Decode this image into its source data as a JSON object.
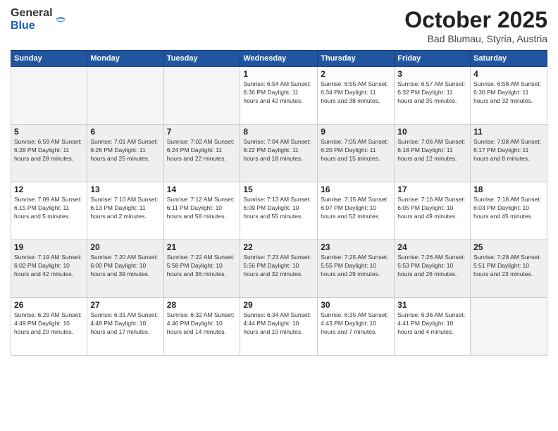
{
  "logo": {
    "general": "General",
    "blue": "Blue"
  },
  "header": {
    "month": "October 2025",
    "location": "Bad Blumau, Styria, Austria"
  },
  "weekdays": [
    "Sunday",
    "Monday",
    "Tuesday",
    "Wednesday",
    "Thursday",
    "Friday",
    "Saturday"
  ],
  "weeks": [
    [
      {
        "day": "",
        "info": ""
      },
      {
        "day": "",
        "info": ""
      },
      {
        "day": "",
        "info": ""
      },
      {
        "day": "1",
        "info": "Sunrise: 6:54 AM\nSunset: 6:36 PM\nDaylight: 11 hours\nand 42 minutes."
      },
      {
        "day": "2",
        "info": "Sunrise: 6:55 AM\nSunset: 6:34 PM\nDaylight: 11 hours\nand 38 minutes."
      },
      {
        "day": "3",
        "info": "Sunrise: 6:57 AM\nSunset: 6:32 PM\nDaylight: 11 hours\nand 35 minutes."
      },
      {
        "day": "4",
        "info": "Sunrise: 6:58 AM\nSunset: 6:30 PM\nDaylight: 11 hours\nand 32 minutes."
      }
    ],
    [
      {
        "day": "5",
        "info": "Sunrise: 6:59 AM\nSunset: 6:28 PM\nDaylight: 11 hours\nand 28 minutes."
      },
      {
        "day": "6",
        "info": "Sunrise: 7:01 AM\nSunset: 6:26 PM\nDaylight: 11 hours\nand 25 minutes."
      },
      {
        "day": "7",
        "info": "Sunrise: 7:02 AM\nSunset: 6:24 PM\nDaylight: 11 hours\nand 22 minutes."
      },
      {
        "day": "8",
        "info": "Sunrise: 7:04 AM\nSunset: 6:22 PM\nDaylight: 11 hours\nand 18 minutes."
      },
      {
        "day": "9",
        "info": "Sunrise: 7:05 AM\nSunset: 6:20 PM\nDaylight: 11 hours\nand 15 minutes."
      },
      {
        "day": "10",
        "info": "Sunrise: 7:06 AM\nSunset: 6:18 PM\nDaylight: 11 hours\nand 12 minutes."
      },
      {
        "day": "11",
        "info": "Sunrise: 7:08 AM\nSunset: 6:17 PM\nDaylight: 11 hours\nand 8 minutes."
      }
    ],
    [
      {
        "day": "12",
        "info": "Sunrise: 7:09 AM\nSunset: 6:15 PM\nDaylight: 11 hours\nand 5 minutes."
      },
      {
        "day": "13",
        "info": "Sunrise: 7:10 AM\nSunset: 6:13 PM\nDaylight: 11 hours\nand 2 minutes."
      },
      {
        "day": "14",
        "info": "Sunrise: 7:12 AM\nSunset: 6:11 PM\nDaylight: 10 hours\nand 58 minutes."
      },
      {
        "day": "15",
        "info": "Sunrise: 7:13 AM\nSunset: 6:09 PM\nDaylight: 10 hours\nand 55 minutes."
      },
      {
        "day": "16",
        "info": "Sunrise: 7:15 AM\nSunset: 6:07 PM\nDaylight: 10 hours\nand 52 minutes."
      },
      {
        "day": "17",
        "info": "Sunrise: 7:16 AM\nSunset: 6:05 PM\nDaylight: 10 hours\nand 49 minutes."
      },
      {
        "day": "18",
        "info": "Sunrise: 7:18 AM\nSunset: 6:03 PM\nDaylight: 10 hours\nand 45 minutes."
      }
    ],
    [
      {
        "day": "19",
        "info": "Sunrise: 7:19 AM\nSunset: 6:02 PM\nDaylight: 10 hours\nand 42 minutes."
      },
      {
        "day": "20",
        "info": "Sunrise: 7:20 AM\nSunset: 6:00 PM\nDaylight: 10 hours\nand 39 minutes."
      },
      {
        "day": "21",
        "info": "Sunrise: 7:22 AM\nSunset: 5:58 PM\nDaylight: 10 hours\nand 36 minutes."
      },
      {
        "day": "22",
        "info": "Sunrise: 7:23 AM\nSunset: 5:56 PM\nDaylight: 10 hours\nand 32 minutes."
      },
      {
        "day": "23",
        "info": "Sunrise: 7:25 AM\nSunset: 5:55 PM\nDaylight: 10 hours\nand 29 minutes."
      },
      {
        "day": "24",
        "info": "Sunrise: 7:26 AM\nSunset: 5:53 PM\nDaylight: 10 hours\nand 26 minutes."
      },
      {
        "day": "25",
        "info": "Sunrise: 7:28 AM\nSunset: 5:51 PM\nDaylight: 10 hours\nand 23 minutes."
      }
    ],
    [
      {
        "day": "26",
        "info": "Sunrise: 6:29 AM\nSunset: 4:49 PM\nDaylight: 10 hours\nand 20 minutes."
      },
      {
        "day": "27",
        "info": "Sunrise: 6:31 AM\nSunset: 4:48 PM\nDaylight: 10 hours\nand 17 minutes."
      },
      {
        "day": "28",
        "info": "Sunrise: 6:32 AM\nSunset: 4:46 PM\nDaylight: 10 hours\nand 14 minutes."
      },
      {
        "day": "29",
        "info": "Sunrise: 6:34 AM\nSunset: 4:44 PM\nDaylight: 10 hours\nand 10 minutes."
      },
      {
        "day": "30",
        "info": "Sunrise: 6:35 AM\nSunset: 4:43 PM\nDaylight: 10 hours\nand 7 minutes."
      },
      {
        "day": "31",
        "info": "Sunrise: 6:36 AM\nSunset: 4:41 PM\nDaylight: 10 hours\nand 4 minutes."
      },
      {
        "day": "",
        "info": ""
      }
    ]
  ]
}
